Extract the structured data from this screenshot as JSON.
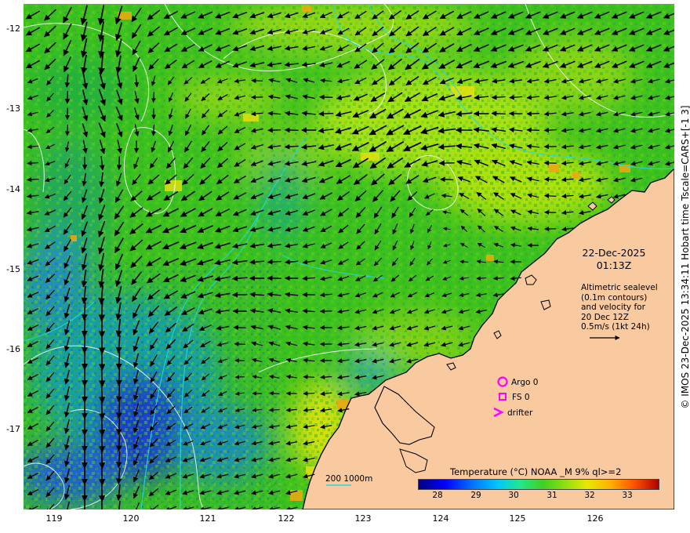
{
  "map": {
    "y_ticks": [
      "-12",
      "-13",
      "-14",
      "-15",
      "-16",
      "-17"
    ],
    "x_ticks": [
      "119",
      "120",
      "121",
      "122",
      "123",
      "124",
      "125",
      "126"
    ],
    "date": "22-Dec-2025",
    "time": "01:13Z",
    "altimetry_note": "Altimetric sealevel\n(0.1m contours)\nand velocity for\n20 Dec 12Z\n0.5m/s (1kt 24h)",
    "legend": {
      "argo": "Argo 0",
      "fs": "FS 0",
      "drifter": "drifter"
    },
    "depth_contours_label": "200  1000m",
    "colorbar": {
      "title": "Temperature (°C) NOAA _M 9% ql>=2",
      "ticks": [
        "28",
        "29",
        "30",
        "31",
        "32",
        "33"
      ],
      "range_c": [
        27.5,
        33.8
      ]
    },
    "credit": "© IMOS 23-Dec-2025 13:34:11 Hobart time Tscale=CARS+[-1 3]",
    "colors": {
      "land": "#f9c9a0",
      "sst_main": "#3cc020",
      "sst_warm": "#b8e410",
      "sst_cool": "#18a8b8",
      "sst_cold": "#1830c8",
      "sealevel_contour": "#ffffff",
      "bathymetry_contour": "#20d8e8",
      "legend_symbols": "#ff00ff"
    }
  }
}
